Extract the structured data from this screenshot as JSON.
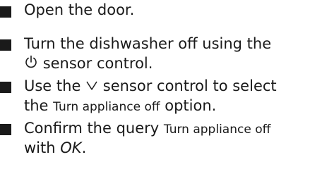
{
  "steps": [
    {
      "lines": [
        [
          "Open the door."
        ]
      ]
    },
    {
      "lines": [
        [
          "Turn the dishwasher off using the"
        ],
        [
          "sensor control."
        ]
      ],
      "icon": "power-icon"
    },
    {
      "lines": [
        [
          "Use the",
          "sensor control to select"
        ],
        [
          "the",
          "Turn appliance off",
          "option."
        ]
      ],
      "icon": "chevron-down-icon"
    },
    {
      "lines": [
        [
          "Confirm the query",
          "Turn appliance off"
        ],
        [
          "with",
          "OK",
          "."
        ]
      ]
    }
  ]
}
